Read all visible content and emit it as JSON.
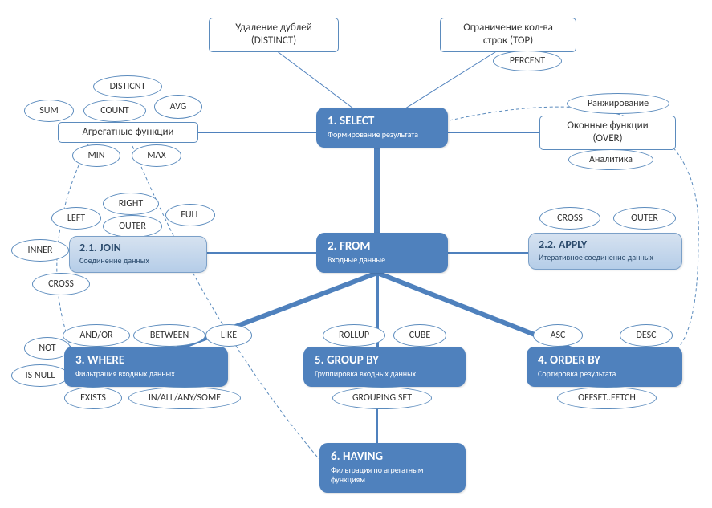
{
  "main": {
    "select": {
      "title": "1. SELECT",
      "sub": "Формирование результата"
    },
    "from": {
      "title": "2. FROM",
      "sub": "Входные данные"
    },
    "where": {
      "title": "3. WHERE",
      "sub": "Фильтрация входных данных"
    },
    "orderby": {
      "title": "4. ORDER BY",
      "sub": "Сортировка результата"
    },
    "groupby": {
      "title": "5. GROUP BY",
      "sub": "Группировка входных данных"
    },
    "having": {
      "title": "6. HAVING",
      "sub": "Фильтрация по агрегатным функциям"
    }
  },
  "sub": {
    "join": {
      "title": "2.1. JOIN",
      "sub": "Соединение данных"
    },
    "apply": {
      "title": "2.2. APPLY",
      "sub": "Итеративное соединение данных"
    }
  },
  "rect": {
    "distinct": "Удаление дублей\n(DISTINCT)",
    "top": "Ограничение кол-ва\nстрок (TOP)",
    "aggregate": "Агрегатные функции",
    "window": "Оконные функции\n(OVER)"
  },
  "ell": {
    "percent": "PERCENT",
    "sum": "SUM",
    "distinct2": "DISTICNT",
    "count": "COUNT",
    "avg": "AVG",
    "min": "MIN",
    "max": "MAX",
    "ranking": "Ранжирование",
    "analytics": "Аналитика",
    "left": "LEFT",
    "right": "RIGHT",
    "full": "FULL",
    "outer_join": "OUTER",
    "inner": "INNER",
    "cross_join": "CROSS",
    "cross_apply": "CROSS",
    "outer_apply": "OUTER",
    "not": "NOT",
    "andor": "AND/OR",
    "between": "BETWEEN",
    "like": "LIKE",
    "isnull": "IS NULL",
    "exists": "EXISTS",
    "inall": "IN/ALL/ANY/SOME",
    "rollup": "ROLLUP",
    "cube": "CUBE",
    "groupingset": "GROUPING SET",
    "asc": "ASC",
    "desc": "DESC",
    "offsetfetch": "OFFSET..FETCH"
  }
}
